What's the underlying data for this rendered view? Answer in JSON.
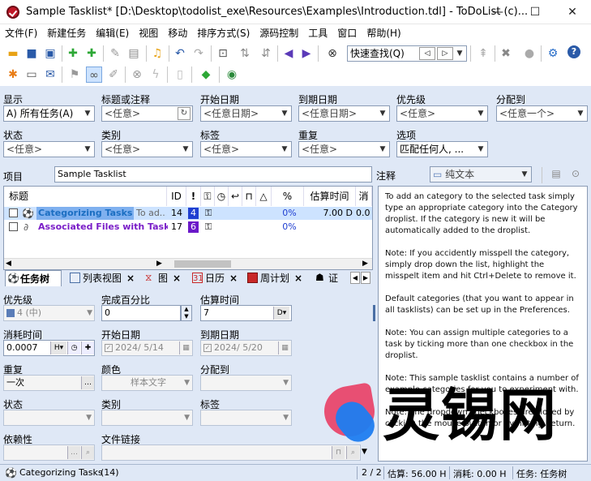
{
  "window": {
    "title": "Sample Tasklist* [D:\\Desktop\\todolist_exe\\Resources\\Examples\\Introduction.tdl] - ToDoList (c)...",
    "minimize": "—",
    "maximize": "☐",
    "close": "✕"
  },
  "menu": [
    "文件(F)",
    "新建任务",
    "编辑(E)",
    "视图",
    "移动",
    "排序方式(S)",
    "源码控制",
    "工具",
    "窗口",
    "帮助(H)"
  ],
  "toolbar": {
    "quickfind_placeholder": "快速查找(Q)"
  },
  "filters": {
    "show_label": "显示",
    "show_value": "A)  所有任务(A)",
    "title_label": "标题或注释",
    "title_value": "<任意>",
    "start_label": "开始日期",
    "start_value": "<任意日期>",
    "due_label": "到期日期",
    "due_value": "<任意日期>",
    "priority_label": "优先级",
    "priority_value": "<任意>",
    "assigned_label": "分配到",
    "assigned_value": "<任意一个>",
    "status_label": "状态",
    "status_value": "<任意>",
    "category_label": "类别",
    "category_value": "<任意>",
    "tags_label": "标签",
    "tags_value": "<任意>",
    "recur_label": "重复",
    "recur_value": "<任意>",
    "options_label": "选项",
    "options_value": "匹配任何人, ..."
  },
  "project": {
    "label": "项目",
    "value": "Sample Tasklist"
  },
  "tasklist": {
    "columns": [
      "标题",
      "ID",
      "!",
      "",
      "",
      "",
      "",
      "",
      "%",
      "估算时间",
      "消"
    ],
    "rows": [
      {
        "title": "Categorizing Tasks",
        "extra": "To ad...",
        "id": "14",
        "priority": "4",
        "percent": "0%",
        "estimate": "7.00 D",
        "spent": "0.0"
      },
      {
        "title": "Associated Files with Tasks",
        "extra": "",
        "id": "17",
        "priority": "6",
        "percent": "0%",
        "estimate": "",
        "spent": ""
      }
    ]
  },
  "tabs": [
    "任务树",
    "列表视图",
    "图",
    "日历",
    "周计划",
    "证"
  ],
  "attributes": {
    "priority_label": "优先级",
    "priority_value": "4 (中)",
    "percent_label": "完成百分比",
    "percent_value": "0",
    "estimate_label": "估算时间",
    "estimate_value": "7",
    "estimate_unit": "D",
    "spent_label": "消耗时间",
    "spent_value": "0.0007",
    "spent_unit": "H",
    "start_label": "开始日期",
    "start_value": "2024/  5/14",
    "due_label": "到期日期",
    "due_value": "2024/  5/20",
    "recur_label": "重复",
    "recur_value": "一次",
    "color_label": "颜色",
    "color_value": "样本文字",
    "assigned_label": "分配到",
    "assigned_value": "",
    "status_label": "状态",
    "category_label": "类别",
    "tags_label": "标签",
    "depends_label": "依赖性",
    "filelink_label": "文件链接"
  },
  "comments": {
    "label": "注释",
    "format": "纯文本",
    "paragraphs": [
      "To add an category to the selected task simply type an appropriate category into the Category droplist. If the category is new it will be automatically added to the droplist.",
      "Note: If you accidently misspell the category, simply drop down the list, highlight the misspelt item and hit Ctrl+Delete to remove it.",
      "Default categories (that you want to appear in all tasklists) can be set up in the Preferences.",
      "Note: You can assign multiple categories to a task by ticking more than one checkbox in the droplist.",
      "Note: This sample tasklist contains a number of example categories for you to experiment with.",
      "Note: The dropdown checkboxes are closed by clicking the mouse button or by hitting Return."
    ]
  },
  "statusbar": {
    "task": "Categorizing Tasks",
    "count": "(14)",
    "position": "2 / 2",
    "estimate": "估算:   56.00 H",
    "spent": "消耗:  0.00 H",
    "view": "任务: 任务树"
  },
  "watermark": {
    "text": "灵锡网"
  },
  "colors": {
    "accent": "#dfe8f6",
    "selection": "#cde3ff",
    "task_blue": "#1b6ec2",
    "task_purple": "#7a1ec8",
    "priority_blue": "#1f3fd1",
    "priority_purple": "#6b19c9"
  }
}
